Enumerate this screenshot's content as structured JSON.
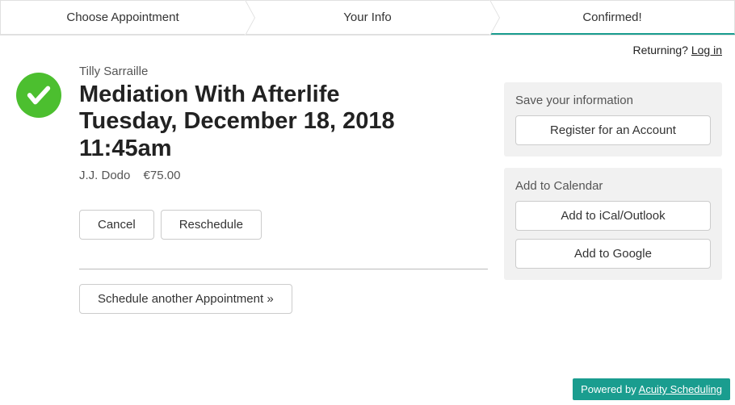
{
  "steps": {
    "choose": "Choose Appointment",
    "info": "Your Info",
    "confirmed": "Confirmed!"
  },
  "topbar": {
    "returning": "Returning?",
    "login": "Log in"
  },
  "confirmation": {
    "client_name": "Tilly Sarraille",
    "service": "Mediation With Afterlife",
    "date_line": "Tuesday, December 18, 2018",
    "time": "11:45am",
    "practitioner": "J.J. Dodo",
    "price": "€75.00"
  },
  "buttons": {
    "cancel": "Cancel",
    "reschedule": "Reschedule",
    "schedule_another": "Schedule another Appointment »"
  },
  "save_card": {
    "title": "Save your information",
    "register": "Register for an Account"
  },
  "calendar_card": {
    "title": "Add to Calendar",
    "ical": "Add to iCal/Outlook",
    "google": "Add to Google"
  },
  "footer": {
    "powered_by": "Powered by",
    "brand": "Acuity Scheduling"
  }
}
